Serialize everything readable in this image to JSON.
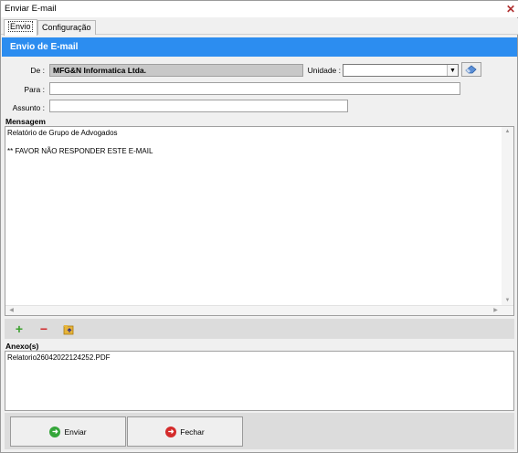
{
  "window": {
    "title": "Enviar E-mail"
  },
  "tabs": [
    {
      "label": "Envio"
    },
    {
      "label": "Configuração"
    }
  ],
  "header": {
    "title": "Envio de E-mail"
  },
  "form": {
    "de_label": "De :",
    "de_value": "MFG&N Informatica Ltda.",
    "unidade_label": "Unidade :",
    "unidade_value": "",
    "para_label": "Para :",
    "para_value": "",
    "assunto_label": "Assunto :",
    "assunto_value": ""
  },
  "mensagem": {
    "label": "Mensagem",
    "lines": [
      "Relatório de Grupo de Advogados",
      "** FAVOR NÃO RESPONDER ESTE E-MAIL"
    ]
  },
  "anexos": {
    "label": "Anexo(s)",
    "files": [
      "Relatorio26042022124252.PDF"
    ]
  },
  "buttons": {
    "enviar": "Enviar",
    "fechar": "Fechar"
  },
  "icons": {
    "close": "close-icon",
    "eraser": "eraser-icon",
    "add": "plus-icon",
    "remove": "minus-icon",
    "attach": "folder-icon",
    "send": "arrow-right-icon",
    "exit": "exit-icon"
  },
  "colors": {
    "header_bg": "#2c8df0",
    "add_icon": "#3aa02c",
    "remove_icon": "#d0282a",
    "send_icon": "#35a63a",
    "exit_icon": "#d42b2b"
  }
}
